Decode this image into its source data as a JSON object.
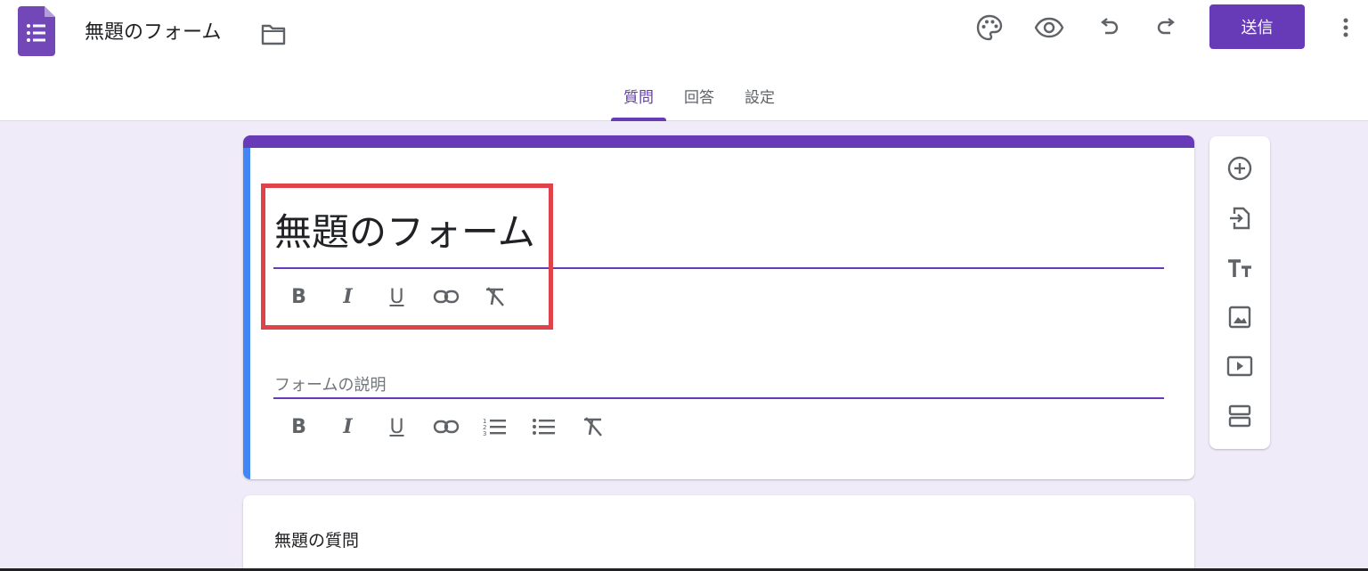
{
  "header": {
    "doc_title": "無題のフォーム",
    "send_label": "送信"
  },
  "tabs": [
    {
      "label": "質問",
      "active": true
    },
    {
      "label": "回答",
      "active": false
    },
    {
      "label": "設定",
      "active": false
    }
  ],
  "title_card": {
    "title": "無題のフォーム",
    "description_placeholder": "フォームの説明"
  },
  "question_card": {
    "title": "無題の質問"
  },
  "icons": {
    "header": [
      "forms-logo-icon",
      "folder-icon",
      "palette-icon",
      "preview-eye-icon",
      "undo-icon",
      "redo-icon",
      "more-vert-icon"
    ],
    "title_toolbar": [
      "bold-icon",
      "italic-icon",
      "underline-icon",
      "link-icon",
      "clear-format-icon"
    ],
    "description_toolbar": [
      "bold-icon",
      "italic-icon",
      "underline-icon",
      "link-icon",
      "numbered-list-icon",
      "bulleted-list-icon",
      "clear-format-icon"
    ],
    "side_tools": [
      "add-question-icon",
      "import-questions-icon",
      "add-title-icon",
      "add-image-icon",
      "add-video-icon",
      "add-section-icon"
    ]
  },
  "colors": {
    "accent": "#673ab7",
    "header_bg": "#ffffff",
    "page_bg": "#f0ebf8",
    "card_left_bar": "#4285f4",
    "highlight_box": "#e0424a"
  }
}
